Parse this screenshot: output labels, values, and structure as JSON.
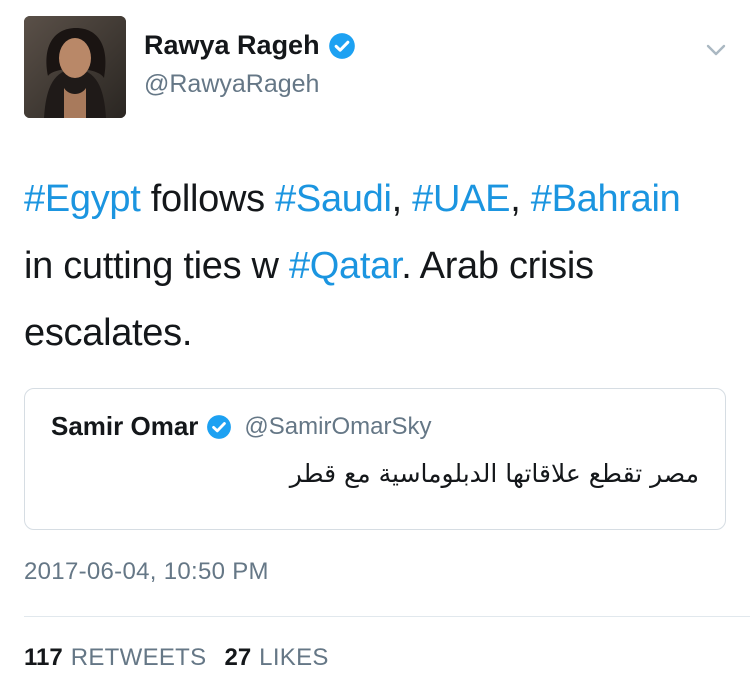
{
  "author": {
    "display_name": "Rawya Rageh",
    "handle": "@RawyaRageh",
    "avatar_icon": "profile-photo",
    "verified_icon": "verified-badge-icon"
  },
  "tweet": {
    "lines": [
      [
        {
          "text": "#Egypt",
          "hashtag": true
        },
        {
          "text": " follows ",
          "hashtag": false
        },
        {
          "text": "#Saudi",
          "hashtag": true
        },
        {
          "text": ", ",
          "hashtag": false
        },
        {
          "text": "#UAE",
          "hashtag": true
        },
        {
          "text": ", ",
          "hashtag": false
        },
        {
          "text": "#Bahrain",
          "hashtag": true
        }
      ],
      [
        {
          "text": "in cutting ties w ",
          "hashtag": false
        },
        {
          "text": "#Qatar",
          "hashtag": true
        },
        {
          "text": ". Arab crisis",
          "hashtag": false
        }
      ],
      [
        {
          "text": "escalates.",
          "hashtag": false
        }
      ]
    ]
  },
  "quoted_tweet": {
    "display_name": "Samir Omar",
    "handle": "@SamirOmarSky",
    "text": "مصر تقطع علاقاتها الدبلوماسية مع قطر"
  },
  "timestamp": "2017-06-04, 10:50 PM",
  "stats": {
    "retweets_count": "117",
    "retweets_label": "RETWEETS",
    "likes_count": "27",
    "likes_label": "LIKES"
  },
  "colors": {
    "hashtag": "#1b95e0",
    "verified": "#1da1f2",
    "secondary_text": "#657786",
    "border": "#d6dde3"
  }
}
